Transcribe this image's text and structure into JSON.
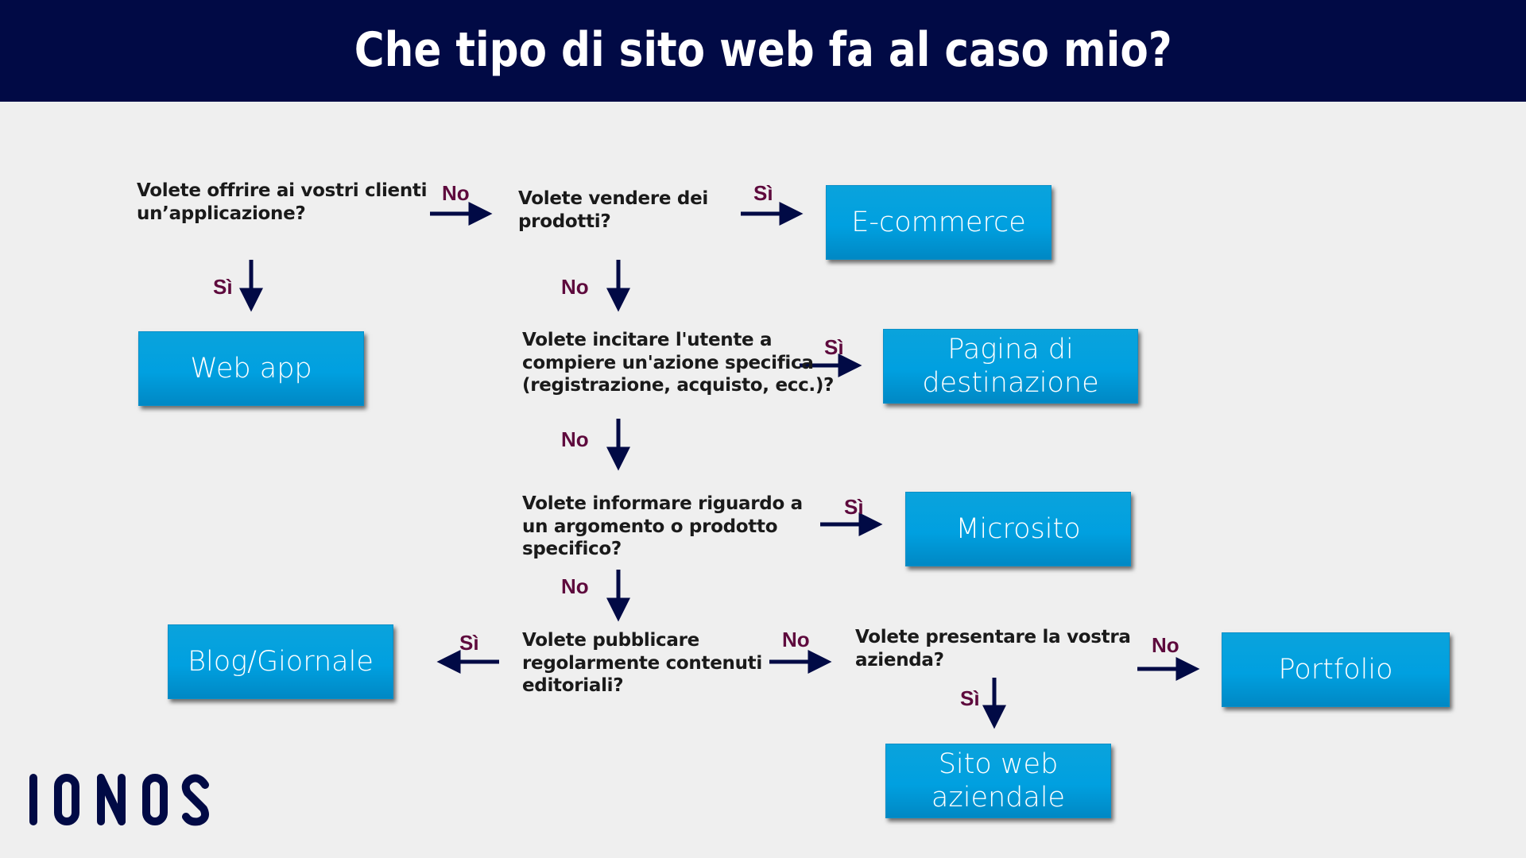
{
  "header": {
    "title": "Che tipo di sito web fa al caso mio?"
  },
  "colors": {
    "header_bg": "#010a45",
    "background": "#efefef",
    "box_fill": "#00a0e0",
    "arrow": "#010a45",
    "label": "#5e0a3d",
    "question_text": "#1a1a1a"
  },
  "questions": {
    "q1": "Volete offrire ai vostri clienti\nun’applicazione?",
    "q2": "Volete vendere dei\nprodotti?",
    "q3": "Volete incitare l'utente a\ncompiere un'azione specifica\n(registrazione, acquisto, ecc.)?",
    "q4": "Volete informare riguardo a\nun argomento o prodotto\nspecifico?",
    "q5": "Volete pubblicare\nregolarmente contenuti\neditoriali?",
    "q6": "Volete presentare la vostra\nazienda?"
  },
  "results": {
    "ecommerce": "E-commerce",
    "webapp": "Web app",
    "landing": "Pagina di\ndestinazione",
    "microsite": "Microsito",
    "blog": "Blog/Giornale",
    "portfolio": "Portfolio",
    "corporate": "Sito web\naziendale"
  },
  "labels": {
    "q1_no": "No",
    "q1_yes": "Sì",
    "q2_yes": "Sì",
    "q2_no": "No",
    "q3_yes": "Sì",
    "q3_no": "No",
    "q4_yes": "Sì",
    "q4_no": "No",
    "q5_yes": "Sì",
    "q5_no": "No",
    "q6_no": "No",
    "q6_yes": "Sì"
  },
  "logo": {
    "text": "IONOS"
  }
}
